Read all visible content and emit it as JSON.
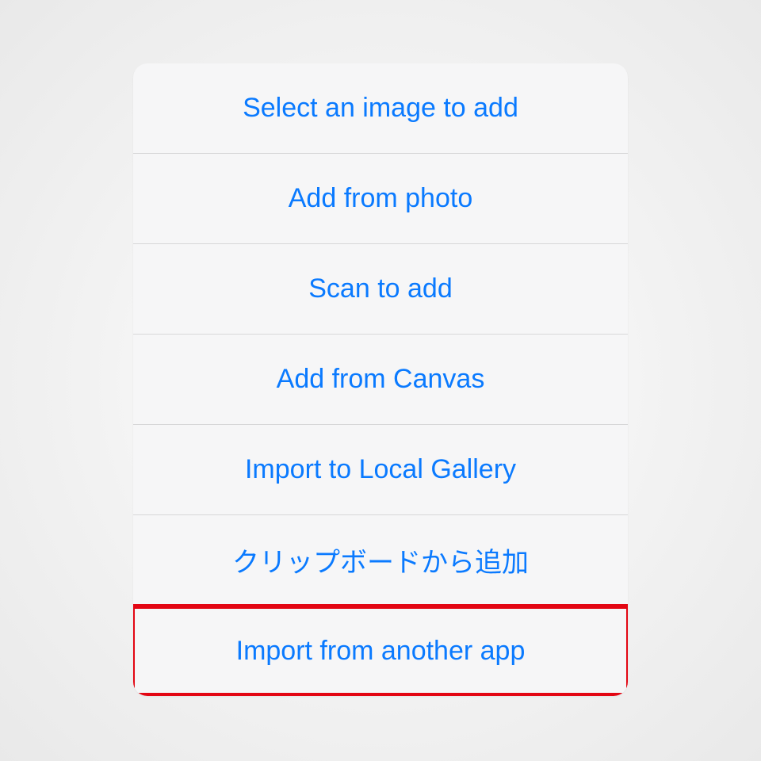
{
  "actionSheet": {
    "items": [
      {
        "label": "Select an image to add",
        "highlighted": false
      },
      {
        "label": "Add from photo",
        "highlighted": false
      },
      {
        "label": "Scan to add",
        "highlighted": false
      },
      {
        "label": "Add from Canvas",
        "highlighted": false
      },
      {
        "label": "Import to Local Gallery",
        "highlighted": false
      },
      {
        "label": "クリップボードから追加",
        "highlighted": false
      },
      {
        "label": "Import from another app",
        "highlighted": true
      }
    ]
  }
}
